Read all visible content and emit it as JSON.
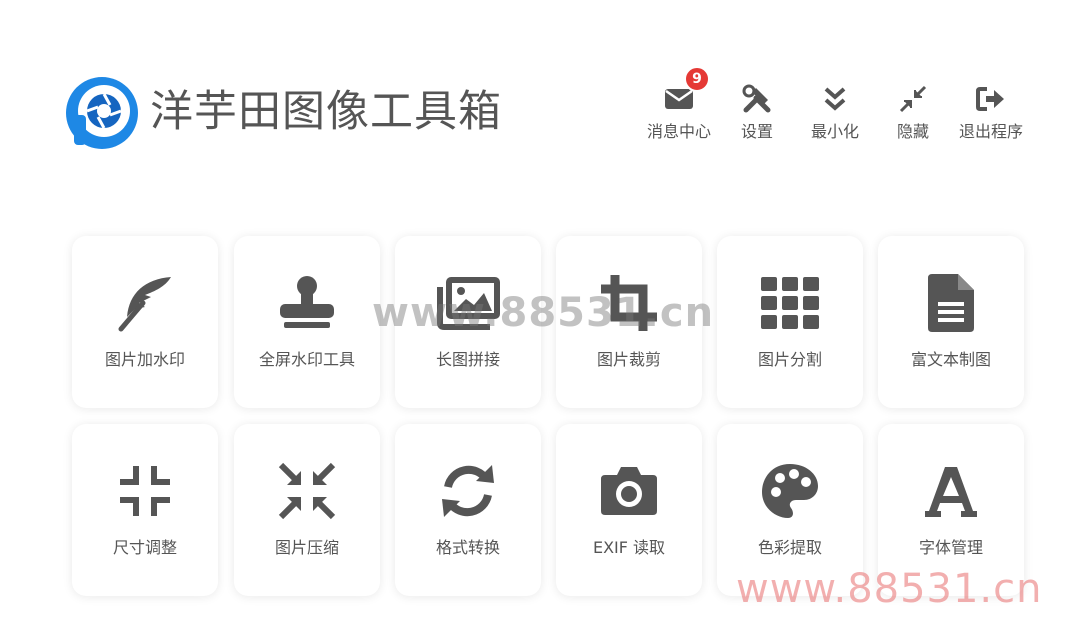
{
  "app": {
    "title": "洋芋田图像工具箱",
    "logo_icon": "camera-aperture-logo-icon",
    "accent": "#1e88e5"
  },
  "header_actions": [
    {
      "label": "消息中心",
      "icon": "envelope-icon",
      "badge": "9"
    },
    {
      "label": "设置",
      "icon": "tools-icon"
    },
    {
      "label": "最小化",
      "icon": "double-chevron-down-icon"
    },
    {
      "label": "隐藏",
      "icon": "compress-arrows-icon"
    },
    {
      "label": "退出程序",
      "icon": "sign-out-icon"
    }
  ],
  "tools": [
    {
      "label": "图片加水印",
      "icon": "feather-icon"
    },
    {
      "label": "全屏水印工具",
      "icon": "stamp-icon"
    },
    {
      "label": "长图拼接",
      "icon": "images-icon"
    },
    {
      "label": "图片裁剪",
      "icon": "crop-icon"
    },
    {
      "label": "图片分割",
      "icon": "grid-icon"
    },
    {
      "label": "富文本制图",
      "icon": "document-icon"
    },
    {
      "label": "尺寸调整",
      "icon": "compress-corners-icon"
    },
    {
      "label": "图片压缩",
      "icon": "compress-arrows-icon"
    },
    {
      "label": "格式转换",
      "icon": "sync-icon"
    },
    {
      "label": "EXIF 读取",
      "icon": "camera-icon"
    },
    {
      "label": "色彩提取",
      "icon": "palette-icon"
    },
    {
      "label": "字体管理",
      "icon": "font-icon"
    }
  ],
  "watermarks": {
    "center": "www.88531.cn",
    "bottom": "www.88531.cn"
  },
  "colors": {
    "icon": "#555555",
    "badge": "#e53935",
    "watermark_red": "#e86e6e"
  }
}
